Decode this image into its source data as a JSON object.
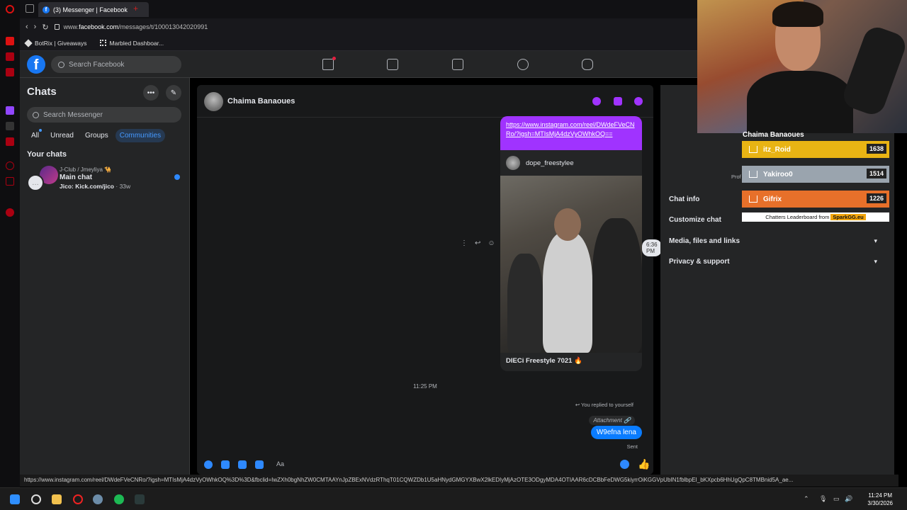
{
  "browser": {
    "tab_title": "(3) Messenger | Facebook",
    "url_prefix": "www.",
    "url_domain": "facebook.com",
    "url_path": "/messages/t/100013042020991",
    "bookmarks": [
      "BotRix | Giveaways",
      "Marbled Dashboar..."
    ],
    "status_url": "https://www.instagram.com/reel/DWdeFVeCNRo/?igsh=MTIsMjA4dzVyOWhkOQ%3D%3D&fbclid=IwZXh0bgNhZW0CMTAAYnJpZBExNVdzRThqT01CQWZDb1U5aHNydGMGYXBwX2lkEDIyMjAzOTE3ODgyMDA4OTIAAR6cDCBbFeDWG5kiyrrOiKGGVpUbIN1fblbpEI_bKXpcb6HhUgQpC8TMBnid5A_ae..."
  },
  "fb": {
    "search_placeholder": "Search Facebook"
  },
  "chats": {
    "title": "Chats",
    "search_placeholder": "Search Messenger",
    "filters": [
      "All",
      "Unread",
      "Groups",
      "Communities"
    ],
    "section": "Your chats",
    "items": [
      {
        "group": "J-Club / Jmeyliya 🐪",
        "name": "Main chat",
        "sender": "Jico: Kick.com/jico",
        "time": "· 33w"
      }
    ]
  },
  "conversation": {
    "name": "Chaima Banaoues",
    "link_text": "https://www.instagram.com/reel/DWdeFVeCNRo/?igsh=MTIsMjA4dzVyOWhkOQ==",
    "ig_user": "dope_freestylee",
    "ig_caption": "DIECi Freestyle 7021 🔥",
    "hover_time": "6:36 PM",
    "timestamp": "11:25 PM",
    "replied_label": "You replied to yourself",
    "attachment_label": "Attachment",
    "sent_message": "W9efna lena",
    "sent_status": "Sent",
    "composer_placeholder": "Aa"
  },
  "info_panel": {
    "items": [
      "Chat info",
      "Customize chat",
      "Media, files and links",
      "Privacy & support"
    ],
    "profile_label": "Prof"
  },
  "leaderboard": {
    "title": "Chaima Banaoues",
    "rows": [
      {
        "name": "itz_Roid",
        "score": "1638",
        "color": "#e8b414"
      },
      {
        "name": "Yakiroo0",
        "score": "1514",
        "color": "#9aa4ae"
      },
      {
        "name": "Gifrix",
        "score": "1226",
        "color": "#e7702a"
      }
    ],
    "footer_text": "Chatters Leaderboard from",
    "footer_brand": "SparkGG.eu"
  },
  "taskbar": {
    "time": "11:24 PM",
    "date": "3/30/2026"
  },
  "colors": {
    "fb_blue": "#1877f2",
    "messenger_purple": "#a033ff",
    "sent_blue": "#0a7cff"
  }
}
